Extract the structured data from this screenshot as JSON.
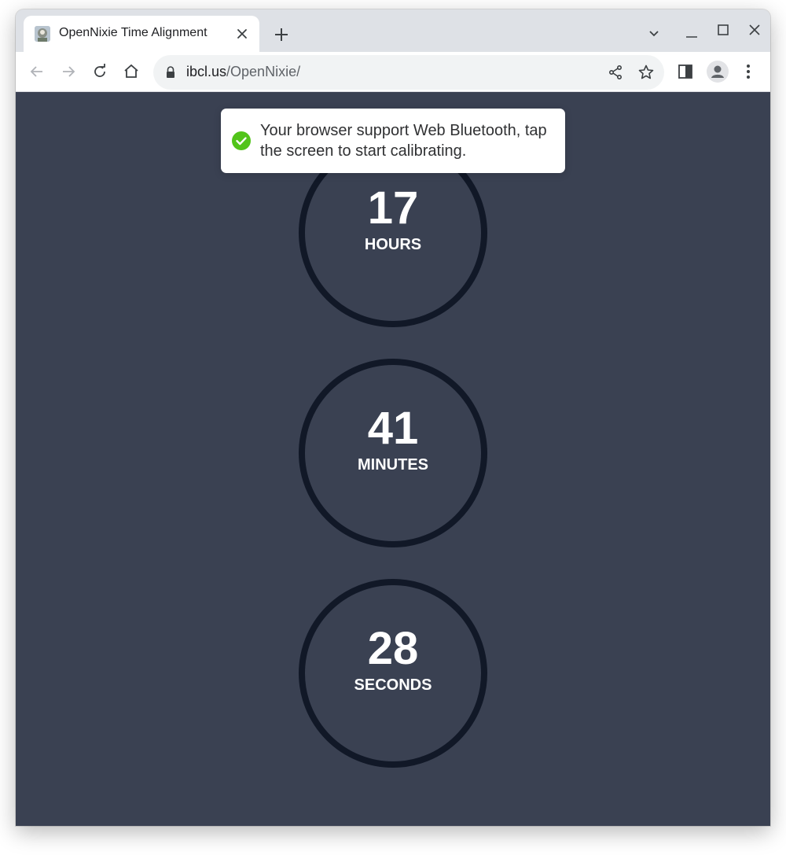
{
  "browser": {
    "tab": {
      "title": "OpenNixie Time Alignment",
      "favicon": "opennixie-favicon"
    },
    "address": {
      "host": "ibcl.us",
      "path": "/OpenNixie/"
    }
  },
  "notification": {
    "message": "Your browser support Web Bluetooth, tap the screen to start calibrating.",
    "icon": "check-circle-icon",
    "icon_color": "#52c41a"
  },
  "clock": {
    "hours": {
      "value": "17",
      "label": "HOURS"
    },
    "minutes": {
      "value": "41",
      "label": "MINUTES"
    },
    "seconds": {
      "value": "28",
      "label": "SECONDS"
    }
  },
  "colors": {
    "background": "#3a4152",
    "ring": "#111827",
    "text": "#ffffff"
  }
}
